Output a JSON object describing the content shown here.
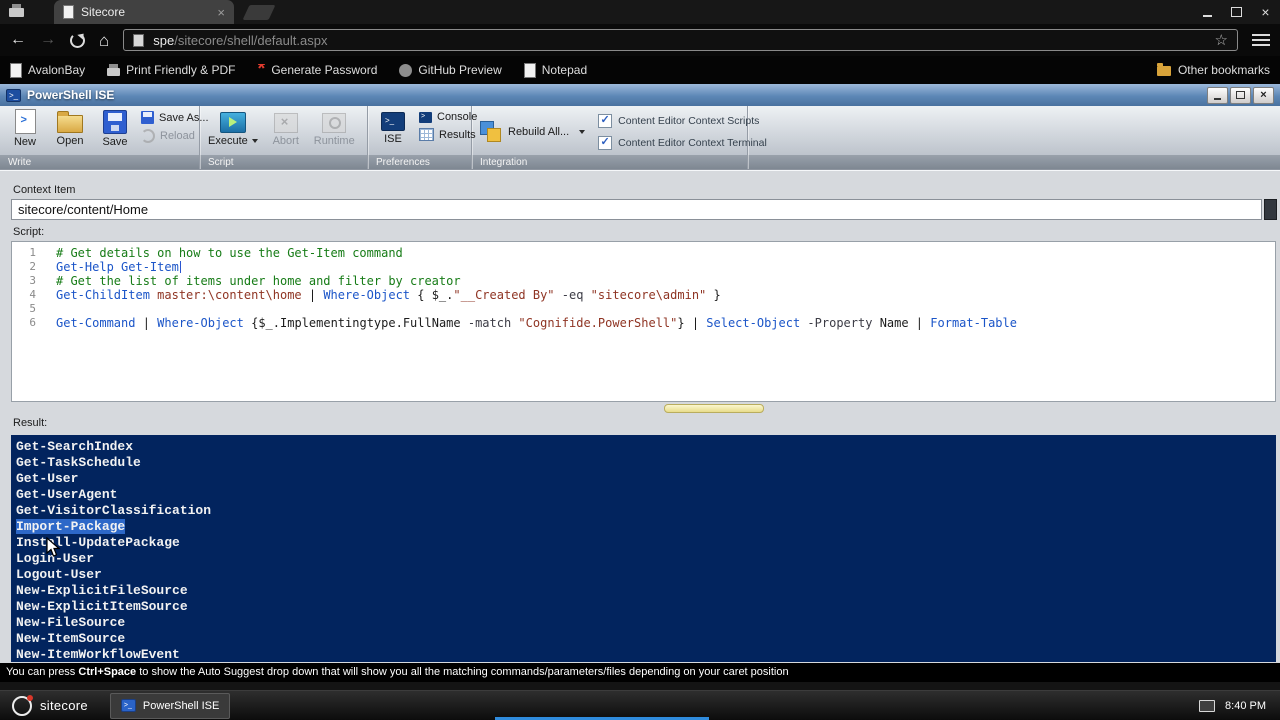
{
  "browser": {
    "tab_title": "Sitecore",
    "address": {
      "url_highlight": "spe",
      "url_rest": "/sitecore/shell/default.aspx"
    },
    "bookmarks_bar": {
      "items": [
        {
          "label": "AvalonBay",
          "icon": "page"
        },
        {
          "label": "Print Friendly & PDF",
          "icon": "printer"
        },
        {
          "label": "Generate Password",
          "icon": "asterisk"
        },
        {
          "label": "GitHub Preview",
          "icon": "github"
        },
        {
          "label": "Notepad",
          "icon": "page"
        }
      ],
      "other_bookmarks_label": "Other bookmarks"
    }
  },
  "ise": {
    "title": "PowerShell ISE",
    "ribbon": {
      "write_group": {
        "label": "Write",
        "new": "New",
        "open": "Open",
        "save": "Save",
        "save_as": "Save As...",
        "reload": "Reload"
      },
      "script_group": {
        "label": "Script",
        "execute": "Execute",
        "abort": "Abort",
        "runtime": "Runtime"
      },
      "preferences_group": {
        "label": "Preferences",
        "ise": "ISE",
        "console": "Console",
        "results": "Results"
      },
      "integration_group": {
        "label": "Integration",
        "rebuild_all": "Rebuild All...",
        "checkbox_scripts": "Content Editor Context Scripts",
        "checkbox_terminal": "Content Editor Context Terminal",
        "checkbox_scripts_checked": true,
        "checkbox_terminal_checked": true
      }
    },
    "context_item": {
      "label": "Context Item",
      "value": "sitecore/content/Home"
    },
    "script_panel": {
      "label": "Script:",
      "lines": [
        {
          "num": "1",
          "cursor": false,
          "segments": [
            {
              "c": "comment",
              "t": "# Get details on how to use the Get-Item command"
            }
          ]
        },
        {
          "num": "2",
          "cursor": true,
          "segments": [
            {
              "c": "cmd",
              "t": "Get-Help"
            },
            {
              "c": "plain",
              "t": " "
            },
            {
              "c": "cmd",
              "t": "Get-Item"
            }
          ]
        },
        {
          "num": "3",
          "cursor": false,
          "segments": [
            {
              "c": "comment",
              "t": "# Get the list of items under home and filter by creator"
            }
          ]
        },
        {
          "num": "4",
          "cursor": false,
          "segments": [
            {
              "c": "cmd",
              "t": "Get-ChildItem"
            },
            {
              "c": "str",
              "t": " master:\\content\\home "
            },
            {
              "c": "plain",
              "t": "| "
            },
            {
              "c": "cmd",
              "t": "Where-Object"
            },
            {
              "c": "plain",
              "t": " { $_."
            },
            {
              "c": "str",
              "t": "\"__Created By\""
            },
            {
              "c": "param",
              "t": " -eq "
            },
            {
              "c": "str",
              "t": "\"sitecore\\admin\""
            },
            {
              "c": "plain",
              "t": " }"
            }
          ]
        },
        {
          "num": "5",
          "cursor": false,
          "segments": []
        },
        {
          "num": "6",
          "cursor": false,
          "segments": [
            {
              "c": "cmd",
              "t": "Get-Command"
            },
            {
              "c": "plain",
              "t": " | "
            },
            {
              "c": "cmd",
              "t": "Where-Object"
            },
            {
              "c": "plain",
              "t": " {$_.Implementingtype.FullName"
            },
            {
              "c": "param",
              "t": " -match "
            },
            {
              "c": "str",
              "t": "\"Cognifide.PowerShell\""
            },
            {
              "c": "plain",
              "t": "} | "
            },
            {
              "c": "cmd",
              "t": "Select-Object"
            },
            {
              "c": "param",
              "t": " -Property "
            },
            {
              "c": "plain",
              "t": "Name | "
            },
            {
              "c": "cmd",
              "t": "Format-Table"
            }
          ]
        }
      ]
    },
    "result_panel": {
      "label": "Result:",
      "items": [
        "Get-SearchIndex",
        "Get-TaskSchedule",
        "Get-User",
        "Get-UserAgent",
        "Get-VisitorClassification",
        "Import-Package",
        "Install-UpdatePackage",
        "Login-User",
        "Logout-User",
        "New-ExplicitFileSource",
        "New-ExplicitItemSource",
        "New-FileSource",
        "New-ItemSource",
        "New-ItemWorkflowEvent"
      ],
      "selected_index": 5,
      "selected_item": "Import-Package"
    },
    "status_bar": {
      "prefix": "You can press ",
      "key": "Ctrl+Space",
      "suffix": " to show the Auto Suggest drop down that will show you all the matching commands/parameters/files depending on your caret position"
    }
  },
  "taskbar": {
    "start_label": "sitecore",
    "task_button": "PowerShell ISE",
    "clock": "8:40 PM"
  },
  "colors": {
    "results_bg": "#02245e",
    "selection_blue": "#2d68c8",
    "comment_green": "#177c17",
    "command_blue": "#1b55c8",
    "string_red": "#8f3423",
    "ise_titlebar_blue": "#5d87b6"
  }
}
